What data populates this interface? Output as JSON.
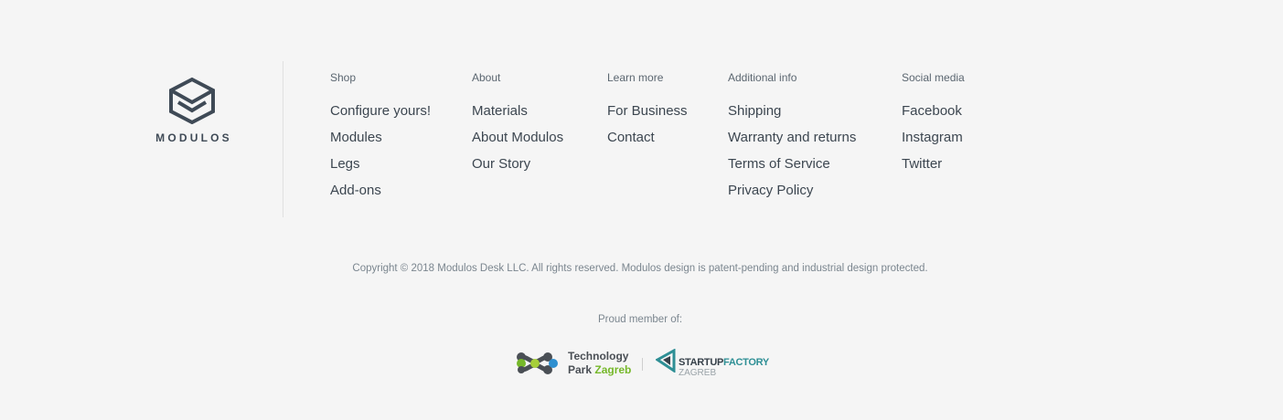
{
  "brand": {
    "name": "MODULOS"
  },
  "columns": [
    {
      "heading": "Shop",
      "items": [
        "Configure yours!",
        "Modules",
        "Legs",
        "Add-ons"
      ]
    },
    {
      "heading": "About",
      "items": [
        "Materials",
        "About Modulos",
        "Our Story"
      ]
    },
    {
      "heading": "Learn more",
      "items": [
        "For Business",
        "Contact"
      ]
    },
    {
      "heading": "Additional info",
      "items": [
        "Shipping",
        "Warranty and returns",
        "Terms of Service",
        "Privacy Policy"
      ]
    },
    {
      "heading": "Social media",
      "items": [
        "Facebook",
        "Instagram",
        "Twitter"
      ]
    }
  ],
  "copyright": "Copyright © 2018 Modulos Desk LLC. All rights reserved. Modulos design is patent-pending and industrial design protected.",
  "members": {
    "label": "Proud member of:",
    "technology_park": {
      "line1": "Technology",
      "line2_a": "Park",
      "line2_b": "Zagreb"
    },
    "startup_factory": {
      "word1": "STARTUP",
      "word2": "FACTORY",
      "sub": "ZAGREB"
    }
  },
  "colors": {
    "background": "#f5f5f5",
    "text": "#3c4650",
    "green": "#76b82a",
    "teal": "#2e8f95"
  },
  "icons": [
    "modulos-cube-logo-icon",
    "technology-park-logo-icon",
    "startup-factory-logo-icon"
  ]
}
